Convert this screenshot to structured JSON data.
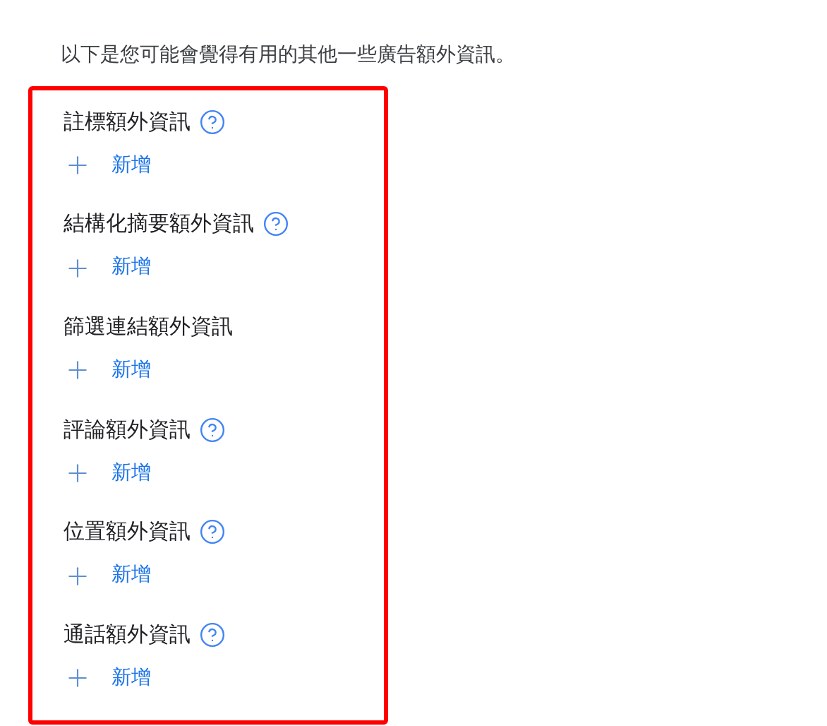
{
  "intro": "以下是您可能會覺得有用的其他一些廣告額外資訊。",
  "highlight": {
    "color": "#ff0000"
  },
  "extensions": [
    {
      "title": "註標額外資訊",
      "help": true,
      "add_label": "新增"
    },
    {
      "title": "結構化摘要額外資訊",
      "help": true,
      "add_label": "新增"
    },
    {
      "title": "篩選連結額外資訊",
      "help": false,
      "add_label": "新增"
    },
    {
      "title": "評論額外資訊",
      "help": true,
      "add_label": "新增"
    },
    {
      "title": "位置額外資訊",
      "help": true,
      "add_label": "新增"
    },
    {
      "title": "通話額外資訊",
      "help": true,
      "add_label": "新增"
    }
  ]
}
